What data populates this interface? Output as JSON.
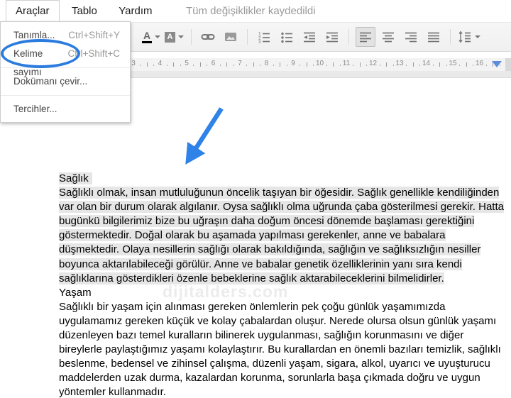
{
  "menu_bar": {
    "items": [
      {
        "label": "Araçlar"
      },
      {
        "label": "Tablo"
      },
      {
        "label": "Yardım"
      }
    ],
    "status": "Tüm değişiklikler kaydedildi"
  },
  "dropdown": {
    "items": [
      {
        "label": "Tanımla...",
        "shortcut": "Ctrl+Shift+Y"
      },
      {
        "label": "Kelime sayımı",
        "shortcut": "Ctrl+Shift+C",
        "circled": true
      },
      {
        "label": "Dokümanı çevir...",
        "shortcut": ""
      },
      {
        "label": "Tercihler...",
        "shortcut": ""
      }
    ]
  },
  "toolbar": {
    "icons": [
      "text-color-icon",
      "highlight-color-icon",
      "insert-link-icon",
      "insert-image-icon",
      "numbered-list-icon",
      "bulleted-list-icon",
      "decrease-indent-icon",
      "increase-indent-icon",
      "align-left-icon",
      "align-center-icon",
      "align-right-icon",
      "justify-icon",
      "line-spacing-icon"
    ],
    "active_button": "align-left",
    "text_color_letter": "A",
    "highlight_letter": "A"
  },
  "ruler": {
    "numbers": [
      3,
      4,
      5,
      6,
      7,
      8,
      9,
      10,
      11,
      12,
      13,
      14,
      15,
      16
    ],
    "marker_color": "#5b8ddb"
  },
  "document": {
    "heading1": "Sağlık",
    "paragraph1": "Sağlıklı olmak, insan mutluluğunun öncelik taşıyan bir öğesidir. Sağlık genellikle kendiliğinden var olan bir durum olarak algılanır. Oysa sağlıklı olma uğrunda çaba gösterilmesi gerekir. Hatta bugünkü bilgilerimiz bize bu uğraşın daha doğum öncesi dönemde başlaması gerektiğini göstermektedir. Doğal olarak bu aşamada yapılması gerekenler, anne ve babalara düşmektedir. Olaya nesillerin sağlığı olarak bakıldığında, sağlığın ve sağlıksızlığın nesiller boyunca aktarılabileceği görülür. Anne ve babalar genetik özelliklerinin yanı sıra kendi sağlıklarına gösterdikleri özenle bebeklerine sağlık aktarabileceklerini bilmelidirler.",
    "heading2": "Yaşam",
    "paragraph2": "Sağlıklı bir yaşam için alınması gereken önlemlerin pek çoğu günlük yaşamımızda  uygulamamız gereken küçük ve kolay çabalardan oluşur. Nerede olursa olsun günlük yaşamı düzenleyen bazı temel kuralların bilinerek uygulanması, sağlığın korunmasını ve diğer bireylerle paylaştığımız yaşamı kolaylaştırır. Bu kurallardan en önemli bazıları temizlik, sağlıklı beslenme, bedensel ve zihinsel çalışma, düzenli yaşam, sigara, alkol, uyarıcı ve uyuşturucu maddelerden uzak durma, kazalardan korunma, sorunlarla başa çıkmada doğru ve uygun yöntemler kullanmadır.",
    "selection_color": "#e6e6e6",
    "watermark": "dijitalders.com"
  },
  "annotations": {
    "circle_color": "#2b7cdf",
    "arrow_color": "#2e82e8"
  }
}
